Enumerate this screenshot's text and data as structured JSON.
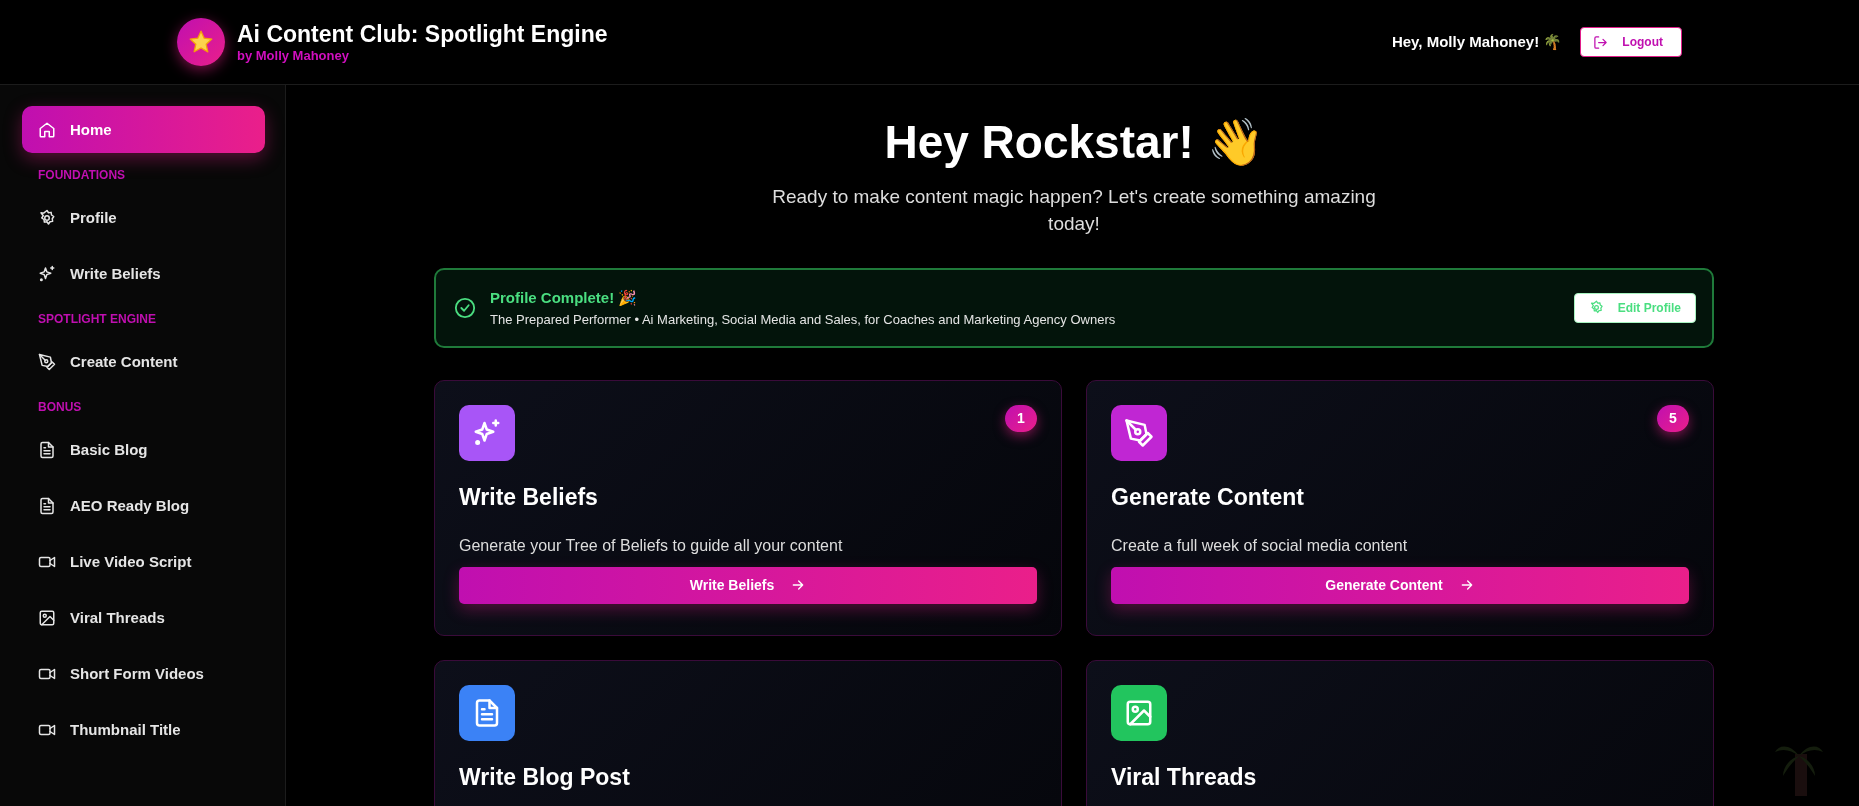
{
  "header": {
    "title": "Ai Content Club: Spotlight Engine",
    "subtitle": "by Molly Mahoney",
    "greeting": "Hey, Molly Mahoney! 🌴",
    "logout": "Logout"
  },
  "sidebar": {
    "items": [
      {
        "kind": "link",
        "label": "Home",
        "selected": true
      },
      {
        "kind": "heading",
        "label": "FOUNDATIONS"
      },
      {
        "kind": "link",
        "label": "Profile",
        "selected": false
      },
      {
        "kind": "link",
        "label": "Write Beliefs",
        "selected": false
      },
      {
        "kind": "heading",
        "label": "SPOTLIGHT ENGINE"
      },
      {
        "kind": "link",
        "label": "Create Content",
        "selected": false
      },
      {
        "kind": "heading",
        "label": "BONUS"
      },
      {
        "kind": "link",
        "label": "Basic Blog",
        "selected": false
      },
      {
        "kind": "link",
        "label": "AEO Ready Blog",
        "selected": false
      },
      {
        "kind": "link",
        "label": "Live Video Script",
        "selected": false
      },
      {
        "kind": "link",
        "label": "Viral Threads",
        "selected": false
      },
      {
        "kind": "link",
        "label": "Short Form Videos",
        "selected": false
      },
      {
        "kind": "link",
        "label": "Thumbnail Title",
        "selected": false
      }
    ]
  },
  "welcome": {
    "title": "Hey Rockstar! 👋",
    "subtitle": "Ready to make content magic happen? Let's create something amazing today!"
  },
  "profile_banner": {
    "title": "Profile Complete! 🎉",
    "details": "The Prepared Performer • Ai Marketing, Social Media and Sales, for Coaches and Marketing Agency Owners",
    "button": "Edit Profile"
  },
  "cards": [
    {
      "title": "Write Beliefs",
      "color": "#a855f7",
      "badge": "1",
      "description": "Generate your Tree of Beliefs to guide all your content",
      "button": "Write Beliefs"
    },
    {
      "title": "Generate Content",
      "color": "#c026d3",
      "badge": "5",
      "description": "Create a full week of social media content",
      "button": "Generate Content"
    },
    {
      "title": "Write Blog Post",
      "color": "#3b82f6"
    },
    {
      "title": "Viral Threads",
      "color": "#22c55e"
    }
  ]
}
